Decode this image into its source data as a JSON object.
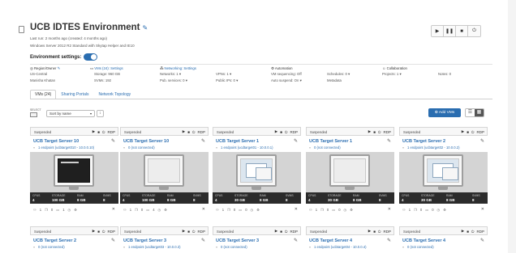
{
  "env": {
    "title": "UCB IDTES Environment",
    "last_run": "Last run: 2 months ago (created: 4 months ago)",
    "description": "Windows Server 2012 R2 Standard with Skytap Helper and IE10",
    "settings_label": "Environment settings:",
    "top_buttons": [
      "▶",
      "❚❚",
      "■",
      "⏻"
    ]
  },
  "settings": {
    "owner": {
      "heading": "Region/Owner",
      "region": "US-Central",
      "owner": "Manisha Khatan"
    },
    "vms": {
      "heading": "VMs (24): Settings",
      "storage": "Storage: 960 GB",
      "svms": "SVMs: 192"
    },
    "networking": {
      "heading": "Networking: Settings",
      "networks": "Networks: 1 ▾",
      "pub_services": "Pub. services: 0 ▾"
    },
    "vpns": {
      "vpns": "VPNs: 1 ▾",
      "public_ips": "Public IPs: 0 ▾"
    },
    "automation": {
      "heading": "Automation",
      "vm_sequencing": "VM sequencing: Off",
      "auto_suspend": "Auto suspend: On ▾"
    },
    "schedules": {
      "schedules": "Schedules: 0 ▾",
      "metadata": "Metadata"
    },
    "collaboration": {
      "heading": "Collaboration",
      "projects": "Projects: 1 ▾",
      "notes": "Notes: 0"
    }
  },
  "tabs": [
    "VMs (24)",
    "Sharing Portals",
    "Network Topology"
  ],
  "toolbar": {
    "select_label": "SELECT",
    "sort": "Sort by name",
    "add_vms": "Add VMs"
  },
  "card_controls": [
    "▶",
    "■",
    "⏻",
    "RDP"
  ],
  "stat_labels": [
    "CPUS",
    "STORAGE",
    "RAM",
    "SVMS"
  ],
  "cards": [
    {
      "status": "Suspended",
      "name": "UCB Target Server 10",
      "endpoint": "1 endpoint (ucbtarget010 - 10.0.0.10)",
      "cpus": "4",
      "storage": "100 GB",
      "ram": "8 GB",
      "svms": "8",
      "screen": "dark",
      "footer": [
        "1",
        "0",
        "1"
      ]
    },
    {
      "status": "Suspended",
      "name": "UCB Target Server 10",
      "endpoint": "0 (not connected)",
      "cpus": "4",
      "storage": "100 GB",
      "ram": "8 GB",
      "svms": "8",
      "screen": "blank",
      "footer": [
        "1",
        "0",
        "4"
      ]
    },
    {
      "status": "Suspended",
      "name": "UCB Target Server 1",
      "endpoint": "1 endpoint (ucdtarget01 - 10.0.0.1)",
      "cpus": "4",
      "storage": "30 GB",
      "ram": "8 GB",
      "svms": "8",
      "screen": "desktop",
      "footer": [
        "1",
        "0",
        "0"
      ]
    },
    {
      "status": "Suspended",
      "name": "UCB Target Server 1",
      "endpoint": "0 (not connected)",
      "cpus": "4",
      "storage": "30 GB",
      "ram": "8 GB",
      "svms": "8",
      "screen": "blank",
      "footer": [
        "1",
        "0",
        "0"
      ]
    },
    {
      "status": "Suspended",
      "name": "UCB Target Server 2",
      "endpoint": "1 endpoint (ucbtarget02 - 10.0.0.2)",
      "cpus": "4",
      "storage": "30 GB",
      "ram": "8 GB",
      "svms": "8",
      "screen": "desktop",
      "footer": [
        "1",
        "0",
        "0"
      ]
    },
    {
      "status": "Suspended",
      "name": "UCB Target Server 2",
      "endpoint": "0 (not connected)"
    },
    {
      "status": "Suspended",
      "name": "UCB Target Server 3",
      "endpoint": "1 endpoint (ucdtarget03 - 10.0.0.3)"
    },
    {
      "status": "Suspended",
      "name": "UCB Target Server 3",
      "endpoint": "0 (not connected)"
    },
    {
      "status": "Suspended",
      "name": "UCB Target Server 4",
      "endpoint": "1 endpoint (ucbtarget04 - 10.0.0.4)"
    },
    {
      "status": "Suspended",
      "name": "UCB Target Server 4",
      "endpoint": "0 (not connected)"
    }
  ],
  "icons": {
    "doc": "document-icon",
    "edit": "pencil-icon",
    "owner": "globe-icon",
    "vms": "monitor-icon",
    "networking": "network-icon",
    "automation": "gear-icon",
    "collaboration": "people-icon",
    "add": "plus-circle-icon",
    "list_view": "list-icon",
    "grid_view": "grid-icon"
  },
  "colors": {
    "accent": "#2a6db0",
    "stats_bar": "#2b2b2b",
    "screen_bg": "#d4d4d4"
  }
}
